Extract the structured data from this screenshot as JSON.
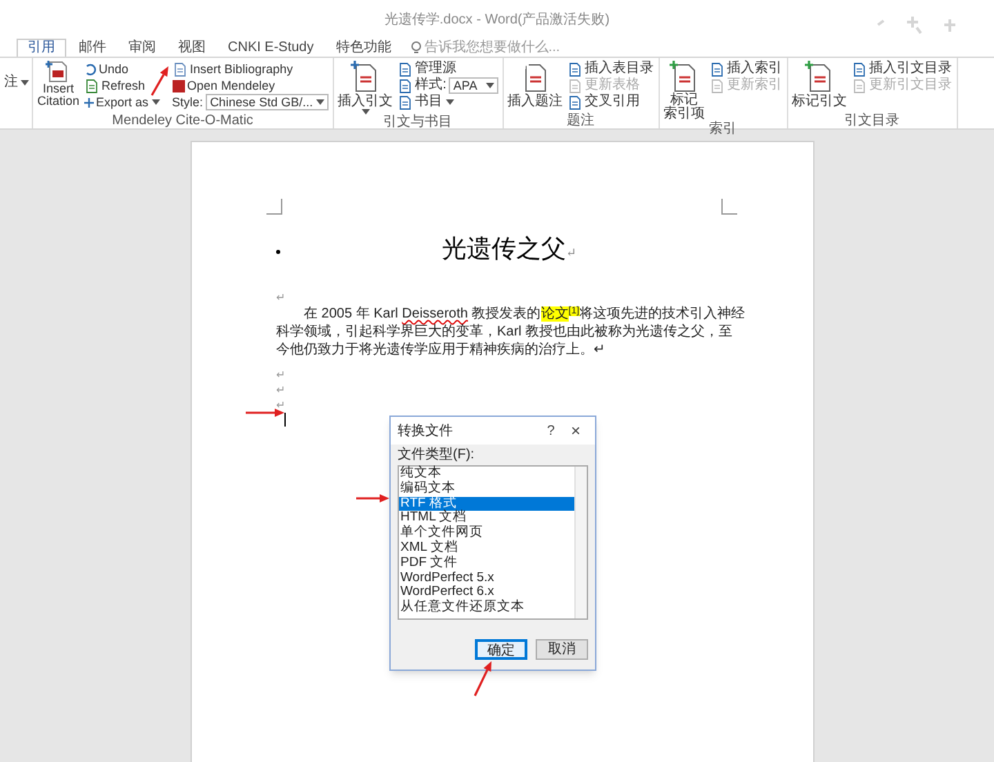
{
  "window": {
    "title": "光遗传学.docx - Word(产品激活失败)"
  },
  "tabs": [
    {
      "label": "引用",
      "selected": true
    },
    {
      "label": "邮件",
      "selected": false
    },
    {
      "label": "审阅",
      "selected": false
    },
    {
      "label": "视图",
      "selected": false
    },
    {
      "label": "CNKI E-Study",
      "selected": false
    },
    {
      "label": "特色功能",
      "selected": false
    }
  ],
  "tell_me": {
    "placeholder": "告诉我您想要做什么..."
  },
  "ribbon": {
    "partial_group": {
      "label": "注"
    },
    "mendeley": {
      "label": "Mendeley Cite-O-Matic",
      "insert_citation": [
        "Insert",
        "Citation"
      ],
      "undo": "Undo",
      "refresh": "Refresh",
      "export": "Export as",
      "insert_bibliography": "Insert Bibliography",
      "open_mendeley": "Open Mendeley",
      "style_label": "Style:",
      "style_value": "Chinese Std GB/..."
    },
    "citations": {
      "label": "引文与书目",
      "insert_citation": "插入引文",
      "manage_sources": "管理源",
      "style_label": "样式:",
      "style_value": "APA",
      "bibliography": "书目"
    },
    "captions": {
      "label": "题注",
      "insert_caption": "插入题注",
      "items": [
        {
          "label": "插入表目录",
          "disabled": false
        },
        {
          "label": "更新表格",
          "disabled": true
        },
        {
          "label": "交叉引用",
          "disabled": false
        }
      ]
    },
    "index": {
      "label": "索引",
      "mark_entry": [
        "标记",
        "索引项"
      ],
      "items": [
        {
          "label": "插入索引",
          "disabled": false
        },
        {
          "label": "更新索引",
          "disabled": true
        }
      ]
    },
    "authorities": {
      "label": "引文目录",
      "mark_citation": "标记引文",
      "items": [
        {
          "label": "插入引文目录",
          "disabled": false
        },
        {
          "label": "更新引文目录",
          "disabled": true
        }
      ]
    }
  },
  "document": {
    "heading": "光遗传之父",
    "heading_mark": "↵",
    "marks_before": [
      "↵"
    ],
    "paragraph": [
      {
        "kind": "plain",
        "text": "在 2005 年 Karl "
      },
      {
        "kind": "misspelled",
        "text": "Deisseroth"
      },
      {
        "kind": "plain",
        "text": " 教授发表的"
      },
      {
        "kind": "highlight",
        "text": "论文"
      },
      {
        "kind": "citation",
        "text": "[1]"
      },
      {
        "kind": "plain",
        "text": "将这项先进的技术引入神经科学领域，引起科学界巨大的变革，Karl 教授也由此被称为光遗传之父，至今他仍致力于将光遗传学应用于精神疾病的治疗上。↵"
      }
    ],
    "marks_after": [
      "↵",
      "↵",
      "↵"
    ]
  },
  "dialog": {
    "title": "转换文件",
    "help": "?",
    "close": "×",
    "list_label": "文件类型(F):",
    "items": [
      {
        "label": "纯文本",
        "selected": false
      },
      {
        "label": "编码文本",
        "selected": false
      },
      {
        "label": "RTF 格式",
        "selected": true
      },
      {
        "label": "HTML 文档",
        "selected": false
      },
      {
        "label": "单个文件网页",
        "selected": false
      },
      {
        "label": "XML 文档",
        "selected": false
      },
      {
        "label": "PDF 文件",
        "selected": false
      },
      {
        "label": "WordPerfect 5.x",
        "selected": false
      },
      {
        "label": "WordPerfect 6.x",
        "selected": false
      },
      {
        "label": "从任意文件还原文本",
        "selected": false
      }
    ],
    "ok": "确定",
    "cancel": "取消"
  }
}
